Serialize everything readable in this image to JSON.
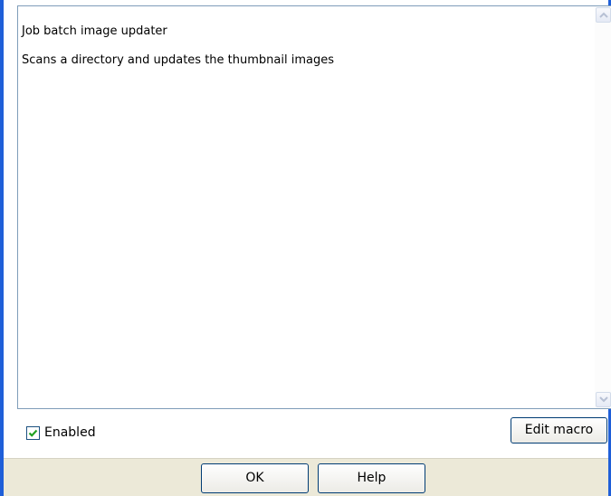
{
  "window": {
    "accent": "#1f5fd8"
  },
  "description": {
    "line1": "Job batch image updater",
    "line2": "Scans a directory and updates the thumbnail images"
  },
  "options": {
    "enabled_label": "Enabled",
    "enabled_checked": true,
    "edit_macro_label": "Edit macro"
  },
  "footer": {
    "ok_label": "OK",
    "help_label": "Help"
  },
  "icons": {
    "scroll_up": "chevron-up-icon",
    "scroll_down": "chevron-down-icon",
    "checkbox": "checkmark-icon"
  }
}
